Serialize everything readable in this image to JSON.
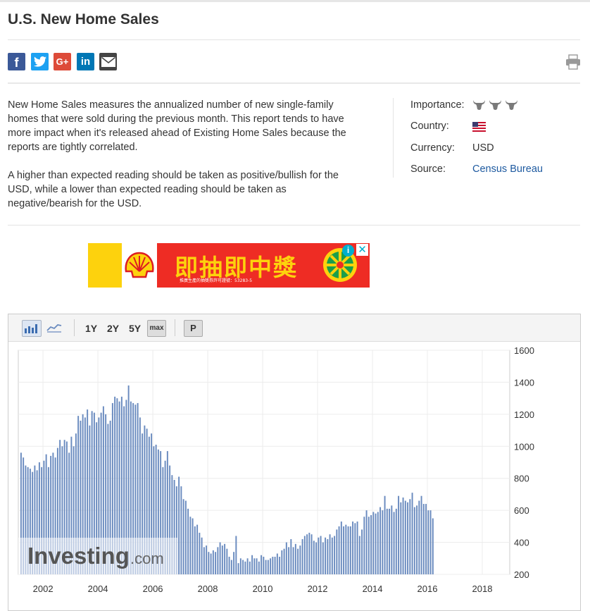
{
  "page": {
    "title": "U.S. New Home Sales"
  },
  "share": {
    "facebook": "f",
    "twitter": "t",
    "googleplus": "G+",
    "linkedin": "in",
    "email": "email-icon"
  },
  "description": {
    "para1": "New Home Sales measures the annualized number of new single-family homes that were sold during the previous month. This report tends to have more impact when it's released ahead of Existing Home Sales because the reports are tightly correlated.",
    "para2": "A higher than expected reading should be taken as positive/bullish for the USD, while a lower than expected reading should be taken as negative/bearish for the USD."
  },
  "info": {
    "importance_label": "Importance:",
    "importance_level": 3,
    "country_label": "Country:",
    "country_flag": "us-flag-icon",
    "currency_label": "Currency:",
    "currency_value": "USD",
    "source_label": "Source:",
    "source_value": "Census Bureau"
  },
  "ad": {
    "headline": "即抽即中獎",
    "fineprint": "推廣生產的抽獎券許可證號：53283-5"
  },
  "toolbar": {
    "range_1y": "1Y",
    "range_2y": "2Y",
    "range_5y": "5Y",
    "range_max": "max",
    "pin": "P"
  },
  "watermark": {
    "brand": "Investing",
    "suffix": ".com"
  },
  "colors": {
    "bar": "#6a8bbf",
    "link": "#1e5aa0",
    "facebook": "#3b5998",
    "twitter": "#1da1f2",
    "googleplus": "#dd4b39",
    "linkedin": "#0077b5"
  },
  "chart_data": {
    "type": "bar",
    "title": "",
    "xlabel": "",
    "ylabel": "",
    "ylim": [
      200,
      1600
    ],
    "y_ticks": [
      1600,
      1400,
      1200,
      1000,
      800,
      600,
      400,
      200
    ],
    "x_ticks": [
      "2002",
      "2004",
      "2006",
      "2008",
      "2010",
      "2012",
      "2014",
      "2016",
      "2018"
    ],
    "x_tick_years": [
      2002,
      2004,
      2006,
      2008,
      2010,
      2012,
      2014,
      2016,
      2018
    ],
    "x_range": [
      2001.1,
      2019.0
    ],
    "y_axis_position": "right",
    "grid": true,
    "series": [
      {
        "start_year": 2001.2,
        "step_years": 0.0833333,
        "values": [
          960,
          930,
          880,
          870,
          860,
          840,
          880,
          850,
          900,
          870,
          910,
          950,
          870,
          940,
          960,
          930,
          990,
          1040,
          1000,
          1040,
          1030,
          960,
          1060,
          1000,
          1080,
          1190,
          1160,
          1200,
          1180,
          1230,
          1130,
          1220,
          1210,
          1150,
          1180,
          1210,
          1250,
          1200,
          1140,
          1160,
          1270,
          1310,
          1300,
          1280,
          1310,
          1250,
          1290,
          1380,
          1280,
          1270,
          1260,
          1270,
          1180,
          1080,
          1130,
          1110,
          1060,
          1080,
          1000,
          1010,
          980,
          970,
          870,
          910,
          970,
          880,
          820,
          790,
          750,
          810,
          750,
          670,
          660,
          610,
          560,
          550,
          500,
          510,
          460,
          430,
          370,
          380,
          340,
          330,
          350,
          340,
          370,
          400,
          380,
          390,
          360,
          310,
          290,
          340,
          440,
          270,
          300,
          290,
          280,
          300,
          280,
          320,
          300,
          300,
          280,
          320,
          310,
          290,
          290,
          300,
          310,
          310,
          330,
          310,
          350,
          360,
          400,
          370,
          420,
          370,
          390,
          360,
          380,
          420,
          440,
          450,
          460,
          450,
          410,
          400,
          430,
          440,
          400,
          430,
          420,
          450,
          430,
          440,
          480,
          500,
          530,
          500,
          510,
          500,
          500,
          530,
          520,
          530,
          440,
          480,
          560,
          600,
          560,
          570,
          590,
          580,
          590,
          620,
          600,
          690,
          610,
          610,
          630,
          590,
          610,
          690,
          650,
          680,
          660,
          650,
          670,
          710,
          620,
          630,
          660,
          690,
          640,
          640,
          600,
          600,
          550
        ]
      }
    ]
  }
}
